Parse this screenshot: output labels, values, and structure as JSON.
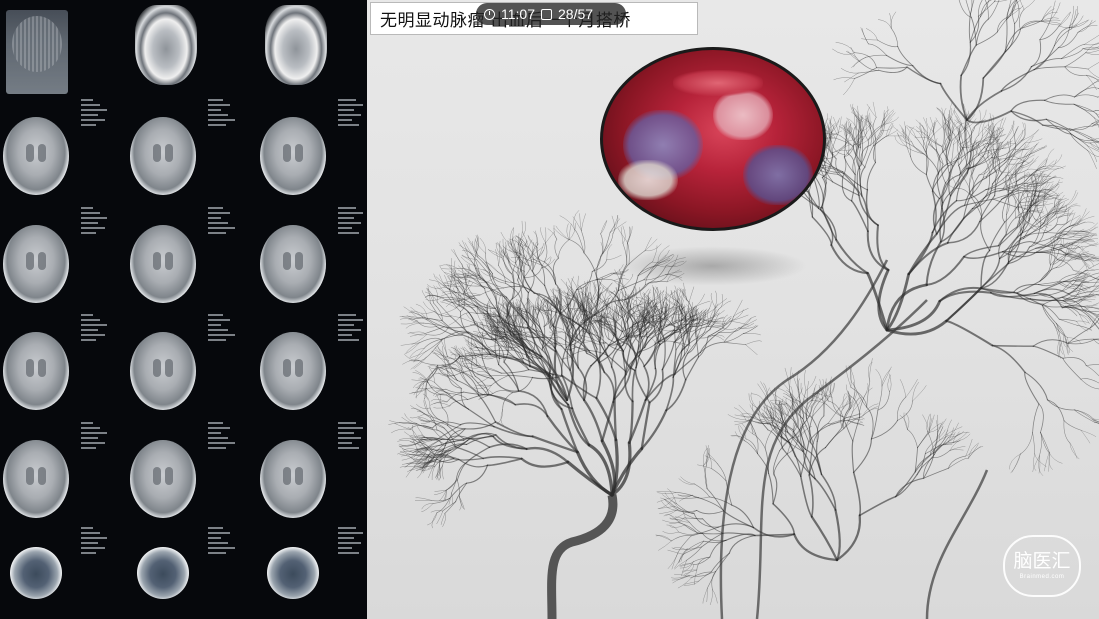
{
  "video": {
    "title": "无明显动脉瘤 出血后一个月搭桥"
  },
  "player": {
    "time": "11:07",
    "slide_counter": "28/57",
    "clock_icon": "clock-icon",
    "slide_icon": "slide-icon"
  },
  "watermark": {
    "name": "脑医汇",
    "url": "Brainmed.com"
  },
  "panels": {
    "left": "ct-film",
    "right": "angiogram",
    "inset": "surgery-inset"
  },
  "colors": {
    "background": "#000000",
    "ct_film": "#06080c",
    "angiogram_bg": "#e4e4e4",
    "vessel": "#2a2a2a",
    "surgery_red": "#b7233a",
    "title_bg": "#ffffff"
  }
}
